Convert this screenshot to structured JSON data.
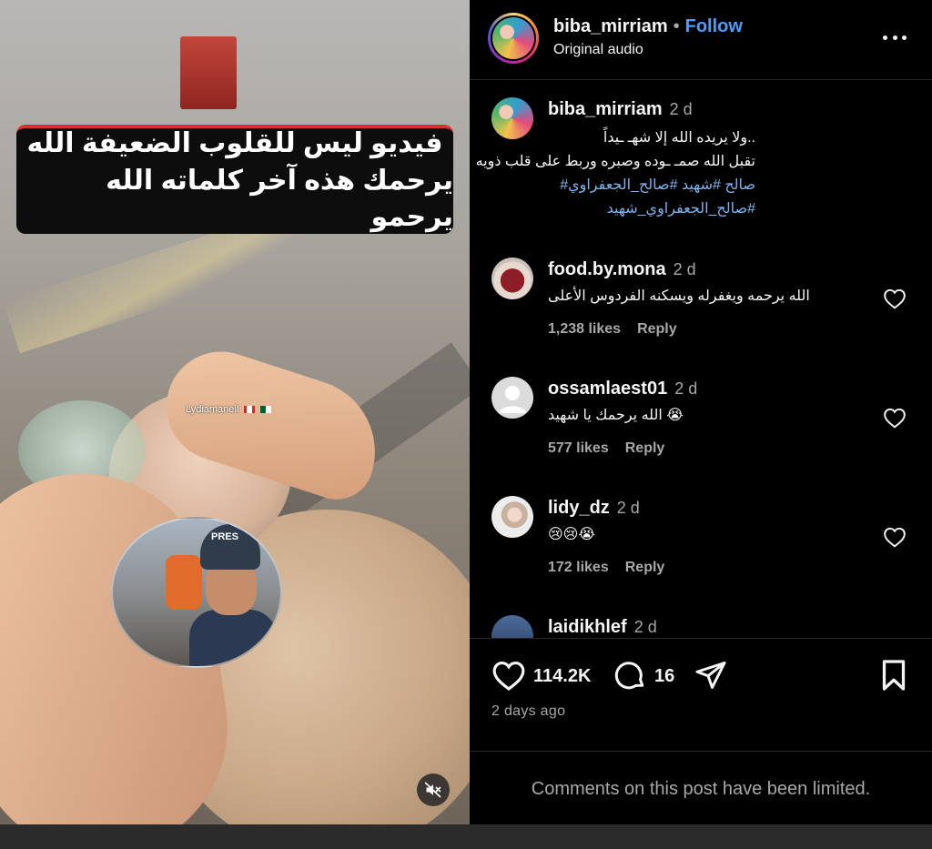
{
  "video": {
    "caption_line1": "فيديو ليس للقلوب الضعيفة الله",
    "caption_line2": "يرحمك هذه آخر كلماته  الله يرحمو",
    "watermark": "Lydiamaneil",
    "reporter_helmet_text": "PRES",
    "mute_icon": "speaker-muted-icon"
  },
  "post_header": {
    "username": "biba_mirriam",
    "separator": "•",
    "follow_label": "Follow",
    "audio_label": "Original audio",
    "more_icon": "more-horizontal-icon"
  },
  "caption_comment": {
    "username": "biba_mirriam",
    "time": "2 d",
    "line1": "..ولا يريده الله إلا شهـ ـيداً",
    "line2": "تقبل الله صمـ ـوده وصبره وربط على قلب ذويه",
    "line3": "صالح #شهيد #صالح_الجعفراوي#",
    "line4": "#صالح_الجعفراوي_شهيد"
  },
  "comments": [
    {
      "username": "food.by.mona",
      "time": "2 d",
      "text": "الله يرحمه ويغفرله ويسكنه الفردوس الأعلى",
      "likes": "1,238 likes",
      "reply": "Reply"
    },
    {
      "username": "ossamlaest01",
      "time": "2 d",
      "text": "الله يرحمك يا شهيد 😭",
      "likes": "577 likes",
      "reply": "Reply"
    },
    {
      "username": "lidy_dz",
      "time": "2 d",
      "text": "😢😢😭",
      "likes": "172 likes",
      "reply": "Reply"
    },
    {
      "username": "laidikhlef",
      "time": "2 d"
    }
  ],
  "actions": {
    "like_count": "114.2K",
    "comment_count": "16",
    "post_time": "2 days ago"
  },
  "footer": {
    "limited_notice": "Comments on this post have been limited."
  },
  "colors": {
    "background": "#000000",
    "link_blue": "#4f9cf5",
    "hashtag_blue": "#7fb3ef",
    "muted_text": "#a8a8a8",
    "caption_red": "#d8322e"
  }
}
